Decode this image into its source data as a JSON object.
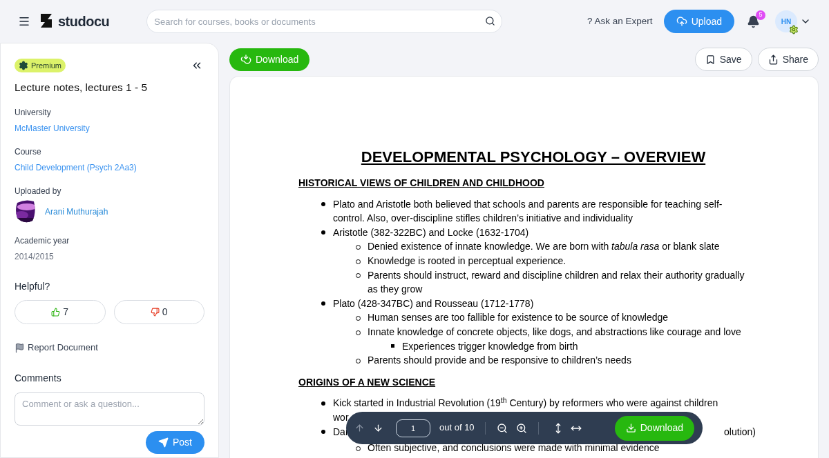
{
  "header": {
    "logo": "studocu",
    "search": {
      "placeholder": "Search for courses, books or documents"
    },
    "ask_expert": "? Ask an Expert",
    "upload": "Upload",
    "notifications": "5",
    "avatar": "HN"
  },
  "sidebar": {
    "badge": "Premium",
    "title": "Lecture notes, lectures 1 - 5",
    "fields": [
      {
        "label": "University",
        "value": "McMaster University",
        "kind": "link"
      },
      {
        "label": "Course",
        "value": "Child Development (Psych 2Aa3)",
        "kind": "link"
      },
      {
        "label": "Uploaded by",
        "value": "Arani Muthurajah",
        "kind": "user"
      },
      {
        "label": "Academic year",
        "value": "2014/2015",
        "kind": "plain"
      }
    ],
    "helpful": "Helpful?",
    "likes": "7",
    "dislikes": "0",
    "report": "Report Document",
    "comments": "Comments",
    "comment_placeholder": "Comment or ask a question...",
    "post": "Post"
  },
  "toolbar_top": {
    "download": "Download",
    "save": "Save",
    "share": "Share"
  },
  "document": {
    "title": "DEVELOPMENTAL PSYCHOLOGY – OVERVIEW",
    "sections": [
      {
        "heading": "HISTORICAL VIEWS OF CHILDREN AND CHILDHOOD",
        "items": [
          {
            "text": "Plato and Aristotle both believed that schools and parents are responsible for teaching self-control. Also, over-discipline stifles children’s initiative and individuality"
          },
          {
            "text": "Aristotle (382-322BC) and Locke (1632-1704)",
            "children": [
              {
                "text": "Denied existence of innate knowledge. We are born with *tabula rasa* or blank slate"
              },
              {
                "text": "Knowledge is rooted in perceptual experience."
              },
              {
                "text": "Parents should instruct, reward and discipline children and relax their authority gradually as they grow"
              }
            ]
          },
          {
            "text": "Plato (428-347BC) and Rousseau (1712-1778)",
            "children": [
              {
                "text": "Human senses are too fallible for existence to be source of knowledge"
              },
              {
                "text": "Innate knowledge of concrete objects, like dogs, and abstractions like courage and love",
                "children": [
                  {
                    "text": "Experiences trigger knowledge from birth"
                  }
                ]
              },
              {
                "text": "Parents should provide and be responsive to children’s needs"
              }
            ]
          }
        ]
      },
      {
        "heading": "ORIGINS OF A NEW SCIENCE",
        "items": [
          {
            "text": "Kick started in Industrial Revolution (19$^{th}$ Century) by reformers who were against children"
          }
        ]
      }
    ],
    "covered": {
      "line_start": "wor",
      "bullet_start": "Dar",
      "bullet_end": "olution)",
      "sub_item": "Often subjective, and conclusions were made with minimal evidence"
    }
  },
  "pager": {
    "page": "1",
    "total": "out of 10",
    "download": "Download"
  }
}
